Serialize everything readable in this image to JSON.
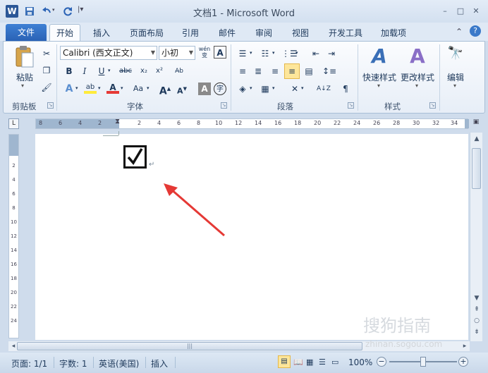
{
  "window": {
    "title": "文档1 - Microsoft Word",
    "app_icon": "W",
    "minimize": "–",
    "maximize": "□",
    "close": "✕"
  },
  "quick_access": [
    "save-icon",
    "undo-icon",
    "redo-icon",
    "customize-icon"
  ],
  "tabs": {
    "file": "文件",
    "items": [
      "开始",
      "插入",
      "页面布局",
      "引用",
      "邮件",
      "审阅",
      "视图",
      "开发工具",
      "加载项"
    ],
    "active": "开始"
  },
  "ribbon": {
    "clipboard": {
      "paste": "粘贴",
      "label": "剪贴板"
    },
    "font": {
      "name": "Calibri (西文正文)",
      "size": "小初",
      "label": "字体",
      "bold": "B",
      "italic": "I",
      "underline": "U",
      "strike": "abc",
      "subscript": "x₂",
      "superscript": "x²",
      "grow": "A",
      "shrink": "A",
      "case": "Aa",
      "wen": "wén\n变"
    },
    "paragraph": {
      "label": "段落"
    },
    "styles": {
      "quick": "快速样式",
      "change": "更改样式",
      "label": "样式"
    },
    "editing": {
      "label": "编辑"
    }
  },
  "ruler": {
    "corner": "L",
    "ticks": [
      "8",
      "6",
      "4",
      "2",
      "2",
      "4",
      "6",
      "8",
      "10",
      "12",
      "14",
      "16",
      "18",
      "20",
      "22",
      "24",
      "26",
      "28",
      "30",
      "32",
      "34"
    ],
    "vticks": [
      "2",
      "4",
      "6",
      "8",
      "10",
      "12",
      "14",
      "16",
      "18",
      "20",
      "22",
      "24"
    ]
  },
  "document": {
    "checkbox_char": "✓",
    "checkbox_checked": true,
    "paragraph_mark": "↵"
  },
  "statusbar": {
    "page": "页面: 1/1",
    "words": "字数: 1",
    "language": "英语(美国)",
    "mode": "插入",
    "zoom": "100%",
    "zoom_out": "−",
    "zoom_in": "+"
  },
  "watermark": {
    "text": "搜狗指南",
    "url": "zhinan.sogou.com"
  },
  "annotation_arrow_color": "#e53935"
}
